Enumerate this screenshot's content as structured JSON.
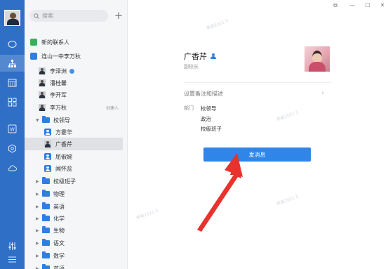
{
  "rail": {
    "icons": [
      "chat-icon",
      "org-icon",
      "calendar-icon",
      "apps-icon",
      "wps-icon",
      "settings-hex-icon",
      "cloud-icon",
      "sliders-icon",
      "menu-icon"
    ]
  },
  "sidebar": {
    "search_placeholder": "搜索",
    "new_contacts": "新的联系人",
    "org": "连山一中李万秋",
    "members": [
      {
        "name": "李泽洲",
        "verified": true,
        "note": ""
      },
      {
        "name": "潘桂馨",
        "verified": false,
        "note": ""
      },
      {
        "name": "李开军",
        "verified": false,
        "note": ""
      },
      {
        "name": "李万秋",
        "verified": false,
        "note": "创建人"
      }
    ],
    "dept_leaders": "校领导",
    "leaders": [
      "方霎华",
      "广香芹",
      "屈俶婉",
      "闻怀蕊"
    ],
    "selected_leader": "广香芹",
    "groups": [
      "校级班子",
      "物理",
      "英语",
      "化学",
      "生物",
      "语文",
      "数学",
      "英语"
    ]
  },
  "detail": {
    "name": "广香芹",
    "title": "副校长",
    "remark_label": "设置备注和描述",
    "dept_label": "部门",
    "departments": [
      "校领导",
      "政治",
      "校级班子"
    ],
    "send_button": "发消息"
  },
  "watermark": "李英2021 5"
}
